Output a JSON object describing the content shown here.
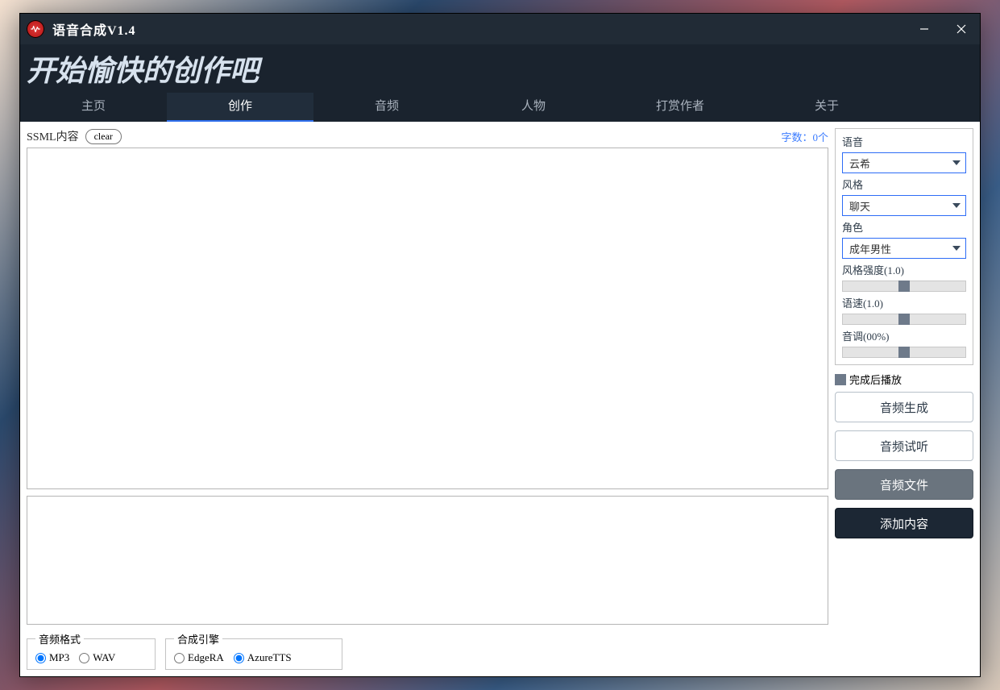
{
  "window": {
    "title": "语音合成V1.4"
  },
  "subtitle": "开始愉快的创作吧",
  "tabs": [
    "主页",
    "创作",
    "音频",
    "人物",
    "打赏作者",
    "关于"
  ],
  "active_tab_index": 1,
  "ssml": {
    "label": "SSML内容",
    "clear": "clear",
    "wordcount": "字数：0个",
    "text1": "",
    "text2": ""
  },
  "format": {
    "legend": "音频格式",
    "options": [
      "MP3",
      "WAV"
    ],
    "selected": "MP3"
  },
  "engine": {
    "legend": "合成引擎",
    "options": [
      "EdgeRA",
      "AzureTTS"
    ],
    "selected": "AzureTTS"
  },
  "panel": {
    "voice_label": "语音",
    "voice_value": "云希",
    "style_label": "风格",
    "style_value": "聊天",
    "role_label": "角色",
    "role_value": "成年男性",
    "intensity_label": "风格强度(1.0)",
    "speed_label": "语速(1.0)",
    "pitch_label": "音调(00%)"
  },
  "check_play_after": "完成后播放",
  "buttons": {
    "generate": "音频生成",
    "preview": "音频试听",
    "file": "音频文件",
    "add": "添加内容"
  }
}
